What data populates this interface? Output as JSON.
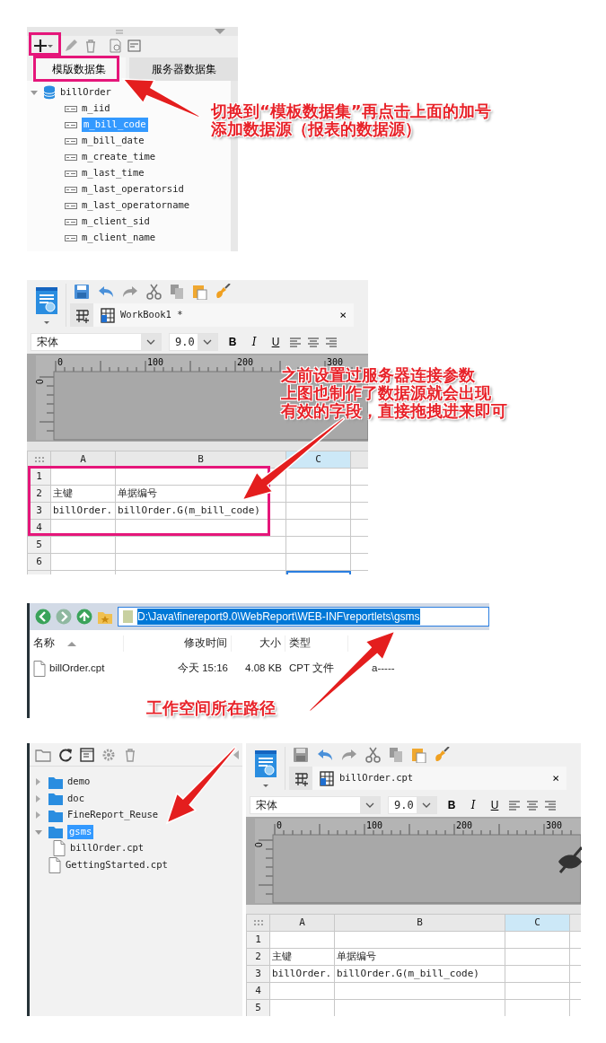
{
  "dataset_panel": {
    "tabs": [
      {
        "label": "模版数据集",
        "selected": true
      },
      {
        "label": "服务器数据集",
        "selected": false
      }
    ],
    "tree": [
      {
        "label": "billOrder",
        "expanded": true,
        "selected": false,
        "children": [
          {
            "label": "m_iid",
            "selected": false
          },
          {
            "label": "m_bill_code",
            "selected": true
          },
          {
            "label": "m_bill_date",
            "selected": false
          },
          {
            "label": "m_create_time",
            "selected": false
          },
          {
            "label": "m_last_time",
            "selected": false
          },
          {
            "label": "m_last_operatorsid",
            "selected": false
          },
          {
            "label": "m_last_operatorname",
            "selected": false
          },
          {
            "label": "m_client_sid",
            "selected": false
          },
          {
            "label": "m_client_name",
            "selected": false
          }
        ]
      }
    ]
  },
  "note_dataset": [
    "切换到“模板数据集”再点击上面的加号",
    "添加数据源（报表的数据源）"
  ],
  "designer_top": {
    "tab_title": "WorkBook1 *",
    "close_symbol": "×",
    "font": "宋体",
    "font_size": "9.0",
    "format_buttons": [
      "B",
      "I",
      "U"
    ],
    "ruler_marks": [
      "0",
      "100",
      "200",
      "300"
    ],
    "vertical_ruler_mark": "0",
    "columns": [
      {
        "label": "A",
        "selected": false
      },
      {
        "label": "B",
        "selected": false
      },
      {
        "label": "C",
        "selected": true
      }
    ],
    "rows": [
      {
        "number": "1"
      },
      {
        "number": "2",
        "cells": [
          "主键",
          "单据编号"
        ]
      },
      {
        "number": "3",
        "cells": [
          "billOrder.",
          "billOrder.G(m_bill_code)"
        ]
      },
      {
        "number": "4"
      },
      {
        "number": "5"
      },
      {
        "number": "6"
      }
    ]
  },
  "note_fields": [
    "之前设置过服务器连接参数",
    "上图也制作了数据源就会出现",
    "有效的字段，直接拖拽进来即可"
  ],
  "explorer": {
    "path": "D:\\Java\\finereport9.0\\WebReport\\WEB-INF\\reportlets\\gsms",
    "columns": [
      "名称",
      "修改时间",
      "大小",
      "类型"
    ],
    "files": [
      {
        "name": "billOrder.cpt",
        "modified": "今天  15:16",
        "size": "4.08 KB",
        "type": "CPT 文件",
        "attributes": "a-----"
      }
    ]
  },
  "note_path": "工作空间所在路径",
  "file_tree": [
    {
      "label": "demo",
      "kind": "folder",
      "expanded": false,
      "selected": false
    },
    {
      "label": "doc",
      "kind": "folder",
      "expanded": false,
      "selected": false
    },
    {
      "label": "FineReport_Reuse",
      "kind": "folder",
      "expanded": false,
      "selected": false
    },
    {
      "label": "gsms",
      "kind": "folder",
      "expanded": true,
      "selected": true,
      "children": [
        {
          "label": "billOrder.cpt",
          "kind": "file",
          "selected": false
        }
      ]
    },
    {
      "label": "GettingStarted.cpt",
      "kind": "file",
      "selected": false
    }
  ],
  "designer_bottom": {
    "tab_title": "billOrder.cpt",
    "close_symbol": "×",
    "font": "宋体",
    "font_size": "9.0",
    "format_buttons": [
      "B",
      "I",
      "U"
    ],
    "ruler_marks": [
      "0",
      "100",
      "200",
      "300"
    ],
    "vertical_ruler_mark": "0",
    "columns": [
      {
        "label": "A",
        "selected": false
      },
      {
        "label": "B",
        "selected": false
      },
      {
        "label": "C",
        "selected": true
      }
    ],
    "rows": [
      {
        "number": "1"
      },
      {
        "number": "2",
        "cells": [
          "主键",
          "单据编号"
        ]
      },
      {
        "number": "3",
        "cells": [
          "billOrder.",
          "billOrder.G(m_bill_code)"
        ]
      },
      {
        "number": "4"
      },
      {
        "number": "5"
      }
    ]
  }
}
